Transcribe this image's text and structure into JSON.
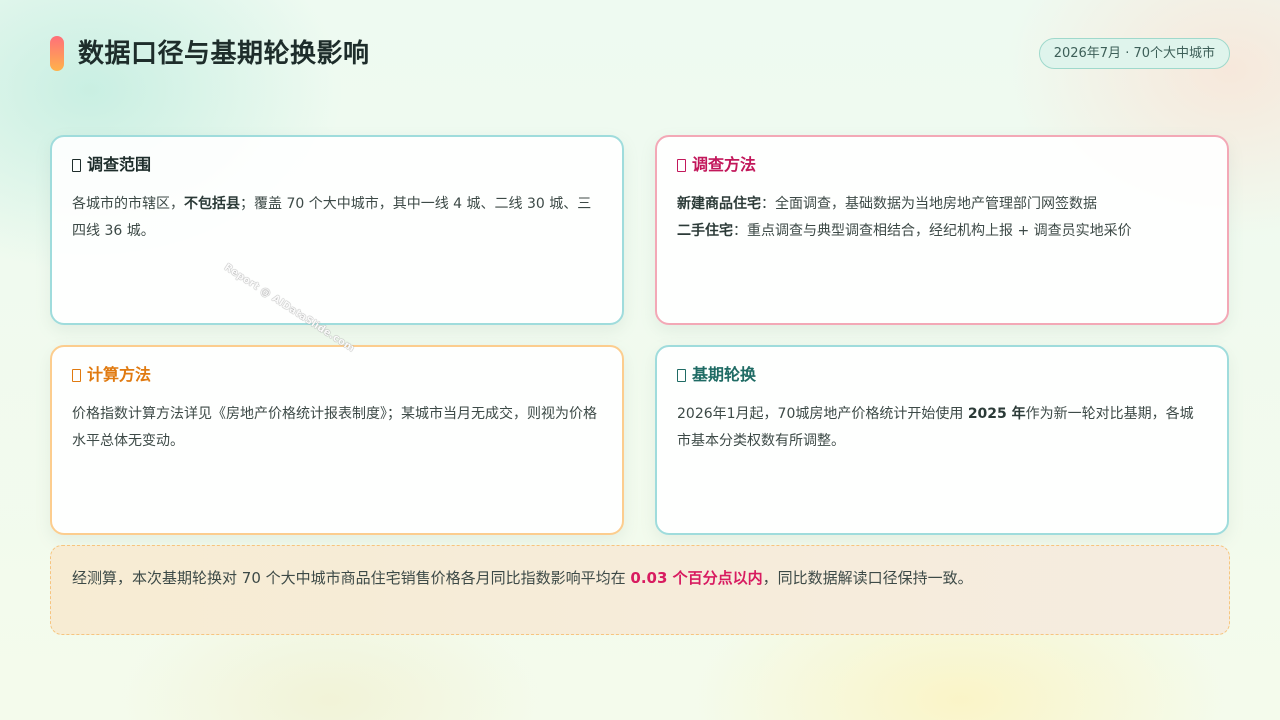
{
  "header": {
    "title": "数据口径与基期轮换影响",
    "date_badge": "2026年7月 · 70个大中城市"
  },
  "cards": [
    {
      "title": "调查范围",
      "body": {
        "p1": "各城市的市辖区，",
        "bold1": "不包括县",
        "p2": "；覆盖 70 个大中城市，其中一线 4 城、二线 30 城、三四线 36 城。"
      }
    },
    {
      "title": "调查方法",
      "line1_label": "新建商品住宅",
      "line1_text": "：全面调查，基础数据为当地房地产管理部门网签数据",
      "line2_label": "二手住宅",
      "line2_text": "：重点调查与典型调查相结合，经纪机构上报 + 调查员实地采价"
    },
    {
      "title": "计算方法",
      "body": "价格指数计算方法详见《房地产价格统计报表制度》；某城市当月无成交，则视为价格水平总体无变动。"
    },
    {
      "title": "基期轮换",
      "body": {
        "p1": "2026年1月起，70城房地产价格统计开始使用 ",
        "bold1": "2025 年",
        "p2": "作为新一轮对比基期，各城市基本分类权数有所调整。"
      }
    }
  ],
  "note": {
    "p1": "经测算，本次基期轮换对 70 个大中城市商品住宅销售价格各月同比指数影响平均在 ",
    "highlight": "0.03 个百分点以内",
    "p2": "，同比数据解读口径保持一致。"
  },
  "watermark": "Report @ AIDataSlide.com",
  "colors": {
    "accent_gradient": [
      "#ff6f7a",
      "#ffb24a"
    ],
    "card_teal": "#9fdcdc",
    "card_pink": "#f3a8b6",
    "card_orange": "#fccd8e",
    "highlight": "#d81b60"
  }
}
